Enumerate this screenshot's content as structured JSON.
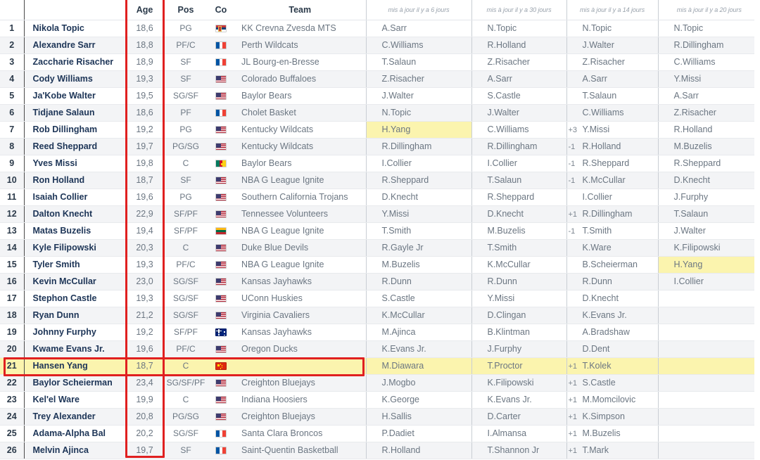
{
  "table": {
    "headers": {
      "rank": "",
      "name": "",
      "age": "Age",
      "pos": "Pos",
      "co": "Co",
      "team": "Team",
      "mock_a": "mis à jour il y a 6 jours",
      "mock_b": "mis à jour il y a 30 jours",
      "mock_c": "mis à jour il y a 14 jours",
      "mock_d": "mis à jour il y a 20 jours"
    },
    "highlight_color": "#fbf4ae",
    "annotation_color": "#e02020",
    "rows": [
      {
        "rank": "1",
        "name": "Nikola Topic",
        "age": "18,6",
        "pos": "PG",
        "flag": "rs",
        "team": "KK Crevna Zvesda MTS",
        "a": "A.Sarr",
        "b": "N.Topic",
        "c": "N.Topic",
        "c_delta": "",
        "d": "N.Topic"
      },
      {
        "rank": "2",
        "name": "Alexandre Sarr",
        "age": "18,8",
        "pos": "PF/C",
        "flag": "fr",
        "team": "Perth Wildcats",
        "a": "C.Williams",
        "b": "R.Holland",
        "c": "J.Walter",
        "c_delta": "",
        "d": "R.Dillingham"
      },
      {
        "rank": "3",
        "name": "Zaccharie Risacher",
        "age": "18,9",
        "pos": "SF",
        "flag": "fr",
        "team": "JL Bourg-en-Bresse",
        "a": "T.Salaun",
        "b": "Z.Risacher",
        "c": "Z.Risacher",
        "c_delta": "",
        "d": "C.Williams"
      },
      {
        "rank": "4",
        "name": "Cody Williams",
        "age": "19,3",
        "pos": "SF",
        "flag": "us",
        "team": "Colorado Buffaloes",
        "a": "Z.Risacher",
        "b": "A.Sarr",
        "c": "A.Sarr",
        "c_delta": "",
        "d": "Y.Missi"
      },
      {
        "rank": "5",
        "name": "Ja'Kobe Walter",
        "age": "19,5",
        "pos": "SG/SF",
        "flag": "us",
        "team": "Baylor Bears",
        "a": "J.Walter",
        "b": "S.Castle",
        "c": "T.Salaun",
        "c_delta": "",
        "d": "A.Sarr"
      },
      {
        "rank": "6",
        "name": "Tidjane Salaun",
        "age": "18,6",
        "pos": "PF",
        "flag": "fr",
        "team": "Cholet Basket",
        "a": "N.Topic",
        "b": "J.Walter",
        "c": "C.Williams",
        "c_delta": "",
        "d": "Z.Risacher"
      },
      {
        "rank": "7",
        "name": "Rob Dillingham",
        "age": "19,2",
        "pos": "PG",
        "flag": "us",
        "team": "Kentucky Wildcats",
        "a": "H.Yang",
        "a_hl": true,
        "b": "C.Williams",
        "c": "Y.Missi",
        "c_delta": "+3",
        "d": "R.Holland"
      },
      {
        "rank": "8",
        "name": "Reed Sheppard",
        "age": "19,7",
        "pos": "PG/SG",
        "flag": "us",
        "team": "Kentucky Wildcats",
        "a": "R.Dillingham",
        "b": "R.Dillingham",
        "c": "R.Holland",
        "c_delta": "-1",
        "d": "M.Buzelis"
      },
      {
        "rank": "9",
        "name": "Yves Missi",
        "age": "19,8",
        "pos": "C",
        "flag": "cm",
        "team": "Baylor Bears",
        "a": "I.Collier",
        "b": "I.Collier",
        "c": "R.Sheppard",
        "c_delta": "-1",
        "d": "R.Sheppard"
      },
      {
        "rank": "10",
        "name": "Ron Holland",
        "age": "18,7",
        "pos": "SF",
        "flag": "us",
        "team": "NBA G League Ignite",
        "a": "R.Sheppard",
        "b": "T.Salaun",
        "c": "K.McCullar",
        "c_delta": "-1",
        "d": "D.Knecht"
      },
      {
        "rank": "11",
        "name": "Isaiah Collier",
        "age": "19,6",
        "pos": "PG",
        "flag": "us",
        "team": "Southern California Trojans",
        "a": "D.Knecht",
        "b": "R.Sheppard",
        "c": "I.Collier",
        "c_delta": "",
        "d": "J.Furphy"
      },
      {
        "rank": "12",
        "name": "Dalton Knecht",
        "age": "22,9",
        "pos": "SF/PF",
        "flag": "us",
        "team": "Tennessee Volunteers",
        "a": "Y.Missi",
        "b": "D.Knecht",
        "c": "R.Dillingham",
        "c_delta": "+1",
        "d": "T.Salaun"
      },
      {
        "rank": "13",
        "name": "Matas Buzelis",
        "age": "19,4",
        "pos": "SF/PF",
        "flag": "lt",
        "team": "NBA G League Ignite",
        "a": "T.Smith",
        "b": "M.Buzelis",
        "c": "T.Smith",
        "c_delta": "-1",
        "d": "J.Walter"
      },
      {
        "rank": "14",
        "name": "Kyle Filipowski",
        "age": "20,3",
        "pos": "C",
        "flag": "us",
        "team": "Duke Blue Devils",
        "a": "R.Gayle Jr",
        "b": "T.Smith",
        "c": "K.Ware",
        "c_delta": "",
        "d": "K.Filipowski"
      },
      {
        "rank": "15",
        "name": "Tyler Smith",
        "age": "19,3",
        "pos": "PF/C",
        "flag": "us",
        "team": "NBA G League Ignite",
        "a": "M.Buzelis",
        "b": "K.McCullar",
        "c": "B.Scheierman",
        "c_delta": "",
        "d": "H.Yang",
        "d_hl": true
      },
      {
        "rank": "16",
        "name": "Kevin McCullar",
        "age": "23,0",
        "pos": "SG/SF",
        "flag": "us",
        "team": "Kansas Jayhawks",
        "a": "R.Dunn",
        "b": "R.Dunn",
        "c": "R.Dunn",
        "c_delta": "",
        "d": "I.Collier"
      },
      {
        "rank": "17",
        "name": "Stephon Castle",
        "age": "19,3",
        "pos": "SG/SF",
        "flag": "us",
        "team": "UConn Huskies",
        "a": "S.Castle",
        "b": "Y.Missi",
        "c": "D.Knecht",
        "c_delta": "",
        "d": ""
      },
      {
        "rank": "18",
        "name": "Ryan Dunn",
        "age": "21,2",
        "pos": "SG/SF",
        "flag": "us",
        "team": "Virginia Cavaliers",
        "a": "K.McCullar",
        "b": "D.Clingan",
        "c": "K.Evans Jr.",
        "c_delta": "",
        "d": ""
      },
      {
        "rank": "19",
        "name": "Johnny Furphy",
        "age": "19,2",
        "pos": "SF/PF",
        "flag": "au",
        "team": "Kansas Jayhawks",
        "a": "M.Ajinca",
        "b": "B.Klintman",
        "c": "A.Bradshaw",
        "c_delta": "",
        "d": ""
      },
      {
        "rank": "20",
        "name": "Kwame Evans Jr.",
        "age": "19,6",
        "pos": "PF/C",
        "flag": "us",
        "team": "Oregon Ducks",
        "a": "K.Evans Jr.",
        "b": "J.Furphy",
        "c": "D.Dent",
        "c_delta": "",
        "d": ""
      },
      {
        "rank": "21",
        "name": "Hansen Yang",
        "age": "18,7",
        "pos": "C",
        "flag": "cn",
        "team": "",
        "a": "M.Diawara",
        "b": "T.Proctor",
        "c": "T.Kolek",
        "c_delta": "+1",
        "d": "",
        "highlight": true
      },
      {
        "rank": "22",
        "name": "Baylor Scheierman",
        "age": "23,4",
        "pos": "SG/SF/PF",
        "flag": "us",
        "team": "Creighton Bluejays",
        "a": "J.Mogbo",
        "b": "K.Filipowski",
        "c": "S.Castle",
        "c_delta": "+1",
        "d": ""
      },
      {
        "rank": "23",
        "name": "Kel'el Ware",
        "age": "19,9",
        "pos": "C",
        "flag": "us",
        "team": "Indiana Hoosiers",
        "a": "K.George",
        "b": "K.Evans Jr.",
        "c": "M.Momcilovic",
        "c_delta": "+1",
        "d": ""
      },
      {
        "rank": "24",
        "name": "Trey Alexander",
        "age": "20,8",
        "pos": "PG/SG",
        "flag": "us",
        "team": "Creighton Bluejays",
        "a": "H.Sallis",
        "b": "D.Carter",
        "c": "K.Simpson",
        "c_delta": "+1",
        "d": ""
      },
      {
        "rank": "25",
        "name": "Adama-Alpha Bal",
        "age": "20,2",
        "pos": "SG/SF",
        "flag": "fr",
        "team": "Santa Clara Broncos",
        "a": "P.Dadiet",
        "b": "I.Almansa",
        "c": "M.Buzelis",
        "c_delta": "+1",
        "d": ""
      },
      {
        "rank": "26",
        "name": "Melvin Ajinca",
        "age": "19,7",
        "pos": "SF",
        "flag": "fr",
        "team": "Saint-Quentin Basketball",
        "a": "R.Holland",
        "b": "T.Shannon Jr",
        "c": "T.Mark",
        "c_delta": "+1",
        "d": ""
      }
    ]
  },
  "annotations": {
    "age_column_box": "Age",
    "highlighted_row_rank": "21",
    "highlighted_row_name": "Hansen Yang"
  }
}
